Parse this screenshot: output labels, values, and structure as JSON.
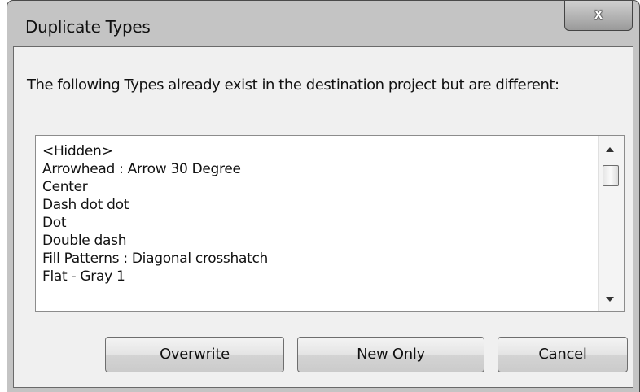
{
  "window": {
    "title": "Duplicate Types",
    "close_glyph": "x"
  },
  "message": "The following Types already exist in the destination project but are different:",
  "list": {
    "items": [
      "<Hidden>",
      "Arrowhead : Arrow 30 Degree",
      "Center",
      "Dash dot dot",
      "Dot",
      "Double dash",
      "Fill Patterns : Diagonal crosshatch",
      "Flat - Gray 1"
    ]
  },
  "buttons": {
    "overwrite": "Overwrite",
    "new_only": "New Only",
    "cancel": "Cancel"
  },
  "icons": {
    "close": "close-icon",
    "scroll_up": "scroll-up-arrow-icon",
    "scroll_down": "scroll-down-arrow-icon"
  },
  "colors": {
    "window_frame": "#c4c4c4",
    "client_background": "#f0f0f0",
    "list_background": "#ffffff"
  }
}
